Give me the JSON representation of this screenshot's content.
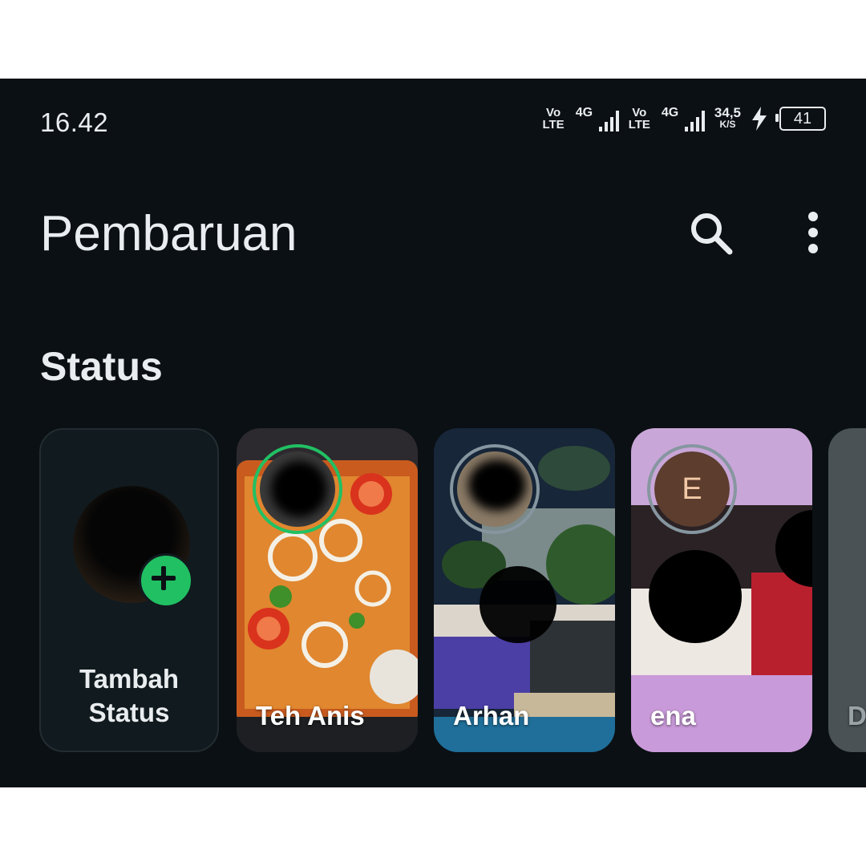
{
  "status_bar": {
    "time": "16.42",
    "volte1_top": "Vo",
    "volte1_bottom": "LTE",
    "net1": "4G",
    "volte2_top": "Vo",
    "volte2_bottom": "LTE",
    "net2": "4G",
    "speed_value": "34,5",
    "speed_unit": "K/S",
    "battery": "41"
  },
  "header": {
    "title": "Pembaruan",
    "search_icon": "search-icon",
    "menu_icon": "more-vert-icon"
  },
  "status_section": {
    "heading": "Status",
    "add_card": {
      "label_line1": "Tambah",
      "label_line2": "Status",
      "icon": "plus-icon"
    },
    "cards": [
      {
        "name": "Teh Anis",
        "ring": "unseen"
      },
      {
        "name": "Arhan",
        "ring": "seen"
      },
      {
        "name": "ena",
        "ring": "seen",
        "avatar_letter": "E"
      },
      {
        "name": "D"
      }
    ]
  },
  "colors": {
    "background": "#0b1014",
    "accent_green": "#21c063",
    "seen_ring": "#8696a0",
    "text": "#e9edef"
  }
}
